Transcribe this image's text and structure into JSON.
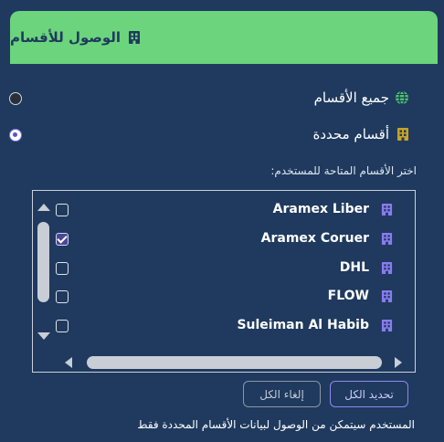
{
  "header": {
    "title": "الوصول للأقسام",
    "icon": "building-icon",
    "background": "#6bd47c"
  },
  "access_options": [
    {
      "label": "جميع الأقسام",
      "icon": "globe-icon",
      "selected": false
    },
    {
      "label": "أقسام محددة",
      "icon": "building-icon",
      "selected": true
    }
  ],
  "department_list": {
    "prompt": "اختر الأقسام المتاحة للمستخدم:",
    "items": [
      {
        "label": "Aramex Liber",
        "checked": false,
        "icon": "building-icon"
      },
      {
        "label": "Aramex Coruer",
        "checked": true,
        "icon": "building-icon"
      },
      {
        "label": "DHL",
        "checked": false,
        "icon": "building-icon"
      },
      {
        "label": "FLOW",
        "checked": false,
        "icon": "building-icon"
      },
      {
        "label": "Suleiman Al Habib",
        "checked": false,
        "icon": "building-icon"
      }
    ]
  },
  "actions": {
    "select_all": "تحديد الكل",
    "clear_all": "إلغاء الكل"
  },
  "footer_note": "المستخدم سيتمكن من الوصول لبيانات الأقسام المحددة فقط",
  "colors": {
    "background": "#1f3a5e",
    "accent": "#7a73e8",
    "building_icon": "#8a7cf0",
    "globe_icon": "#4cc46a",
    "gold_icon": "#c9a227"
  }
}
